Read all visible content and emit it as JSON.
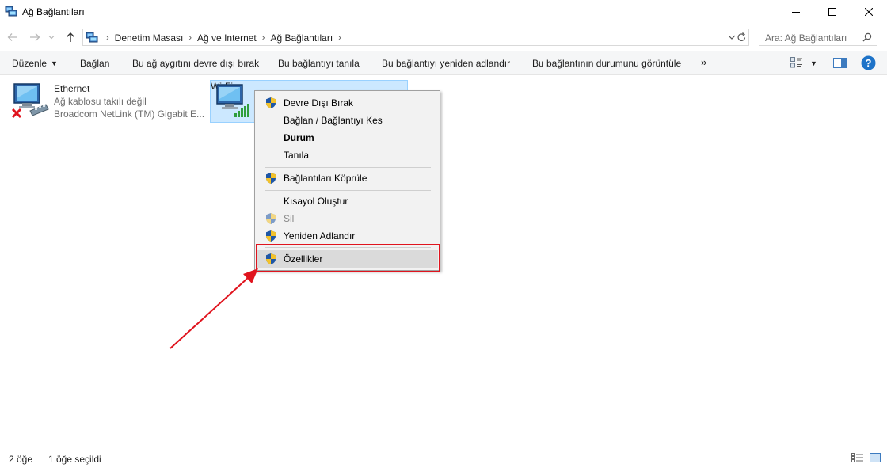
{
  "window": {
    "title": "Ağ Bağlantıları",
    "icon": "network-connections-icon",
    "controls": [
      "minimize-icon",
      "maximize-icon",
      "close-icon"
    ]
  },
  "navigation": {
    "back_icon": "arrow-left-icon",
    "forward_icon": "arrow-right-icon",
    "recent_icon": "chevron-down-icon",
    "up_icon": "arrow-up-icon",
    "breadcrumbs": [
      "Denetim Masası",
      "Ağ ve Internet",
      "Ağ Bağlantıları"
    ],
    "search_placeholder": "Ara: Ağ Bağlantıları"
  },
  "toolbar": {
    "organize": "Düzenle",
    "connect": "Bağlan",
    "disable": "Bu ağ aygıtını devre dışı bırak",
    "diagnose": "Bu bağlantıyı tanıla",
    "rename": "Bu bağlantıyı yeniden adlandır",
    "status": "Bu bağlantının durumunu görüntüle",
    "more": "»"
  },
  "connections": [
    {
      "name": "Ethernet",
      "status": "Ağ kablosu takılı değil",
      "device": "Broadcom NetLink (TM) Gigabit E...",
      "icon": "ethernet-disconnected-icon"
    },
    {
      "name": "Wi-Fi",
      "icon": "wifi-signal-icon",
      "selected": true
    }
  ],
  "context_menu": {
    "items": [
      {
        "label": "Devre Dışı Bırak",
        "shield": true
      },
      {
        "label": "Bağlan / Bağlantıyı Kes",
        "shield": false
      },
      {
        "label": "Durum",
        "shield": false,
        "bold": true
      },
      {
        "label": "Tanıla",
        "shield": false
      },
      {
        "label": "Bağlantıları Köprüle",
        "shield": true
      },
      {
        "label": "Kısayol Oluştur",
        "shield": false
      },
      {
        "label": "Sil",
        "shield": true,
        "disabled": true
      },
      {
        "label": "Yeniden Adlandır",
        "shield": true
      },
      {
        "label": "Özellikler",
        "shield": true,
        "highlighted": true
      }
    ]
  },
  "status_bar": {
    "count": "2 öğe",
    "selected": "1 öğe seçildi"
  },
  "colors": {
    "annotation": "#e0141e",
    "selection": "#cce8ff",
    "help": "#1e73c8"
  }
}
